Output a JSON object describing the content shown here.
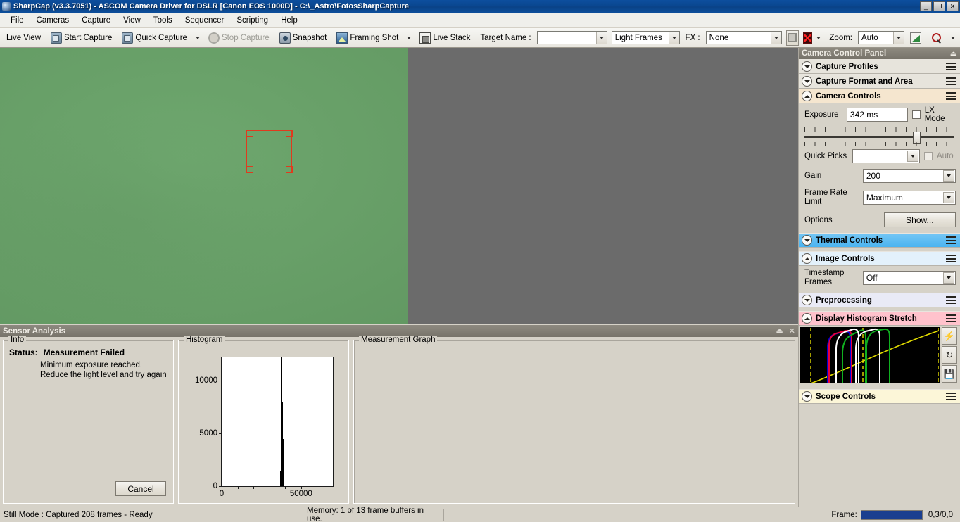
{
  "window": {
    "title": "SharpCap (v3.3.7051) - ASCOM Camera Driver for DSLR [Canon EOS 1000D] - C:\\_Astro\\FotosSharpCapture",
    "icon": "sharpcap-app-icon",
    "minimize": "_",
    "maximize": "❐",
    "close": "✕"
  },
  "menu": {
    "items": [
      {
        "label": "File"
      },
      {
        "label": "Cameras"
      },
      {
        "label": "Capture"
      },
      {
        "label": "View"
      },
      {
        "label": "Tools"
      },
      {
        "label": "Sequencer"
      },
      {
        "label": "Scripting"
      },
      {
        "label": "Help"
      }
    ]
  },
  "toolbar": {
    "live_view": "Live View",
    "start_capture": "Start Capture",
    "quick_capture": "Quick Capture",
    "stop_capture": "Stop Capture",
    "snapshot": "Snapshot",
    "framing_shot": "Framing Shot",
    "live_stack": "Live Stack",
    "target_name_label": "Target Name :",
    "target_name_value": "",
    "frame_type_value": "Light Frames",
    "fx_label": "FX :",
    "fx_value": "None",
    "zoom_label": "Zoom:",
    "zoom_value": "Auto"
  },
  "preview": {
    "roi_label": "region-of-interest-selection",
    "background_color": "#6b6b6b",
    "image_color": "#68a168",
    "roi_color": "#e03a1e"
  },
  "camera_control_panel": {
    "title": "Camera Control Panel",
    "pin": "⏏",
    "sections": [
      {
        "label": "Capture Profiles",
        "state": "collapsed",
        "color": "#e7e4dc"
      },
      {
        "label": "Capture Format and Area",
        "state": "collapsed",
        "color": "#e7e4dc"
      },
      {
        "label": "Camera Controls",
        "state": "expanded",
        "color": "#f5e6cf"
      },
      {
        "label": "Thermal Controls",
        "state": "collapsed",
        "color": "#4bb4f0"
      },
      {
        "label": "Image Controls",
        "state": "expanded",
        "color": "#e3f1fb"
      },
      {
        "label": "Preprocessing",
        "state": "collapsed",
        "color": "#e9eaf6"
      },
      {
        "label": "Display Histogram Stretch",
        "state": "expanded",
        "color": "#ffc2cc"
      },
      {
        "label": "Scope Controls",
        "state": "collapsed",
        "color": "#fcf6d8"
      }
    ],
    "camera_controls": {
      "exposure_label": "Exposure",
      "exposure_value": "342 ms",
      "lx_mode_label": "LX Mode",
      "lx_mode_checked": false,
      "quick_picks_label": "Quick Picks",
      "quick_picks_value": "",
      "auto_label": "Auto",
      "auto_checked": false,
      "gain_label": "Gain",
      "gain_value": "200",
      "frame_rate_limit_label": "Frame Rate Limit",
      "frame_rate_limit_value": "Maximum",
      "options_label": "Options",
      "options_button": "Show..."
    },
    "image_controls": {
      "timestamp_label": "Timestamp Frames",
      "timestamp_value": "Off"
    },
    "histogram_stretch": {
      "auto_stretch_icon": "lightning-icon",
      "reset_icon": "reset-icon",
      "save_icon": "save-icon"
    }
  },
  "sensor_analysis": {
    "title": "Sensor Analysis",
    "pin": "⏏",
    "close": "✕",
    "info": {
      "legend": "Info",
      "status_label": "Status:",
      "status_value": "Measurement Failed",
      "message": "Minimum exposure reached. Reduce the light level and try again",
      "cancel_button": "Cancel"
    },
    "histogram": {
      "legend": "Histogram"
    },
    "measurement_graph": {
      "legend": "Measurement Graph"
    }
  },
  "statusbar": {
    "mode": "Still Mode : Captured 208 frames - Ready",
    "memory": "Memory: 1 of 13 frame buffers in use.",
    "frame_label": "Frame:",
    "frame_progress_percent": 100,
    "frame_coords": "0,3/0,0"
  },
  "chart_data": {
    "type": "bar",
    "title": "Histogram",
    "xlabel": "",
    "ylabel": "",
    "xlim": [
      0,
      70000
    ],
    "ylim": [
      0,
      12200
    ],
    "yticks": [
      0,
      5000,
      10000
    ],
    "ytick_labels": [
      "0",
      "5000",
      "10000"
    ],
    "xticks": [
      0,
      10000,
      20000,
      30000,
      40000,
      50000,
      60000
    ],
    "xtick_labels": [
      "0",
      "",
      "",
      "",
      "",
      "50000",
      ""
    ],
    "grid": false,
    "legend": null,
    "bars": [
      {
        "x": 36800,
        "value": 1400
      },
      {
        "x": 37100,
        "value": 5200
      },
      {
        "x": 37400,
        "value": 12200
      },
      {
        "x": 37700,
        "value": 8000
      },
      {
        "x": 38000,
        "value": 4500
      },
      {
        "x": 38300,
        "value": 900
      }
    ],
    "notes": "Single narrow spike near ADU 37000, peak clipped at top of plot."
  }
}
